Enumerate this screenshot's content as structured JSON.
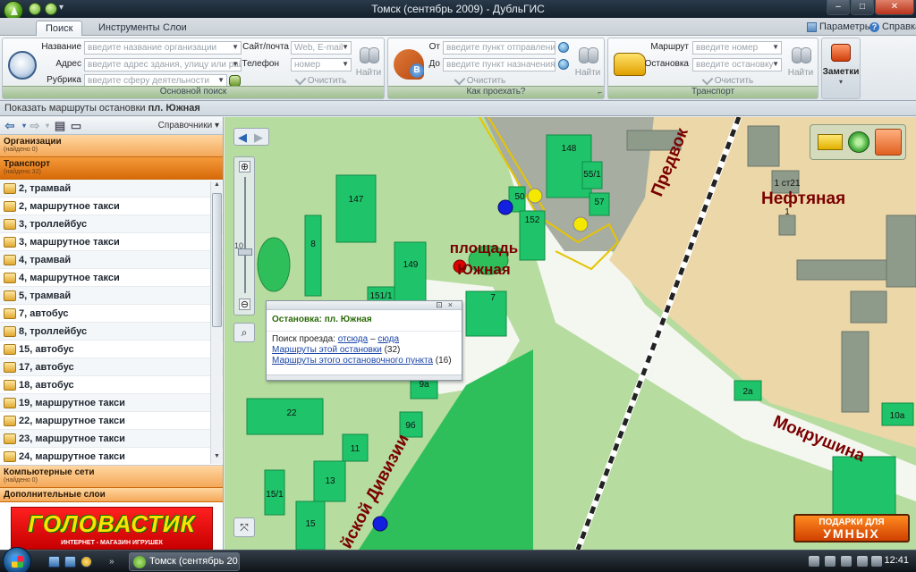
{
  "window": {
    "title": "Томск (сентябрь 2009) - ДубльГИС"
  },
  "tabs": [
    {
      "label": "Поиск",
      "active": true
    },
    {
      "label": "Инструменты",
      "active": false
    },
    {
      "label": "Слои",
      "active": false
    }
  ],
  "topright": {
    "params_label": "Параметры",
    "help_label": "Справка"
  },
  "ribbon": {
    "main_search": {
      "group_label": "Основной поиск",
      "name_label": "Название",
      "name_placeholder": "введите название организации",
      "address_label": "Адрес",
      "address_placeholder": "введите адрес здания, улицу или район",
      "rubric_label": "Рубрика",
      "rubric_placeholder": "введите сферу деятельности",
      "site_label": "Сайт/почта",
      "site_placeholder": "Web, E-mail",
      "phone_label": "Телефон",
      "phone_placeholder": "номер",
      "find_label": "Найти",
      "clear_label": "Очистить"
    },
    "route": {
      "group_label": "Как проехать?",
      "from_label": "От",
      "from_placeholder": "введите пункт отправления",
      "to_label": "До",
      "to_placeholder": "введите пункт назначения",
      "find_label": "Найти",
      "clear_label": "Очистить"
    },
    "transport": {
      "group_label": "Транспорт",
      "route_label": "Маршрут",
      "route_placeholder": "введите номер",
      "stop_label": "Остановка",
      "stop_placeholder": "введите остановку",
      "find_label": "Найти",
      "clear_label": "Очистить"
    },
    "notes_label": "Заметки"
  },
  "status": {
    "prefix": "Показать маршруты остановки ",
    "stop": "пл. Южная"
  },
  "left": {
    "directories_label": "Справочники",
    "categories": {
      "organizations": {
        "name": "Организации",
        "count": "(найдено 0)"
      },
      "transport": {
        "name": "Транспорт",
        "count": "(найдено 32)"
      },
      "networks": {
        "name": "Компьютерные сети",
        "count": "(найдено 0)"
      },
      "layers": {
        "name": "Дополнительные слои"
      }
    },
    "routes": [
      "2, трамвай",
      "2, маршрутное такси",
      "3, троллейбус",
      "3, маршрутное такси",
      "4, трамвай",
      "4, маршрутное такси",
      "5, трамвай",
      "7, автобус",
      "8, троллейбус",
      "15, автобус",
      "17, автобус",
      "18, автобус",
      "19, маршрутное такси",
      "22, маршрутное такси",
      "23, маршрутное такси",
      "24, маршрутное такси"
    ]
  },
  "ad": {
    "brand": "ГОЛОВАСТИК",
    "sub": "ИНТЕРНЕТ - МАГАЗИН ИГРУШЕК"
  },
  "map": {
    "square_label_1": "площадь",
    "square_label_2": "Южная",
    "streets": {
      "neftyanaya": "Нефтяная",
      "predvokzalnaya": "Предвок",
      "mokrushina": "Мокрушина",
      "division": "йской Дивизии"
    },
    "buildings": [
      "147",
      "148",
      "8",
      "149",
      "151/1",
      "7",
      "50",
      "152",
      "55/1",
      "57",
      "1",
      "1 ст21",
      "22",
      "9а",
      "9б",
      "11",
      "13",
      "15/1",
      "15",
      "2а",
      "10а"
    ],
    "banner_1": "ПОДАРКИ ДЛЯ",
    "banner_2": "УМНЫХ",
    "zoom_label": "10"
  },
  "popup": {
    "title": "Остановка: пл. Южная",
    "search_label": "Поиск проезда:",
    "from_link": "отсюда",
    "dash": "–",
    "to_link": "сюда",
    "routes_link": "Маршруты этой остановки",
    "routes_count": "(32)",
    "point_link": "Маршруты этого остановочного пункта",
    "point_count": "(16)"
  },
  "taskbar": {
    "task_label": "Томск (сентябрь 20...",
    "time": "12:41"
  }
}
